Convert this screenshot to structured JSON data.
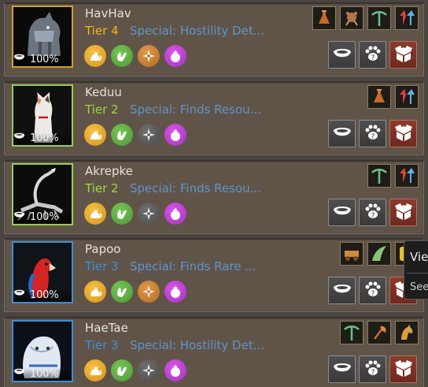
{
  "colors": {
    "tier4": "#f1b51f",
    "tier2": "#9dd83b",
    "tier3": "#3f8fd6",
    "border_gold": "#d4a020",
    "border_green": "#99cc55",
    "border_blue": "#3a8fd5"
  },
  "pets": [
    {
      "name": "HavHav",
      "tier": "Tier 4",
      "tier_color": "#f1b51f",
      "border_color": "#d4a020",
      "special": "Special: Hostility Det...",
      "hunger": "100%",
      "portrait": "armored-dog",
      "skills": [
        "gold-cat",
        "green-paw",
        "orange-compass",
        "purple-bag"
      ],
      "passives": [
        "potion-icon",
        "bear-icon",
        "pickaxe-icon",
        "speed-up-icon"
      ]
    },
    {
      "name": "Keduu",
      "tier": "Tier 2",
      "tier_color": "#9dd83b",
      "border_color": "#99cc55",
      "special": "Special: Finds Resou...",
      "hunger": "100%",
      "portrait": "white-cat",
      "skills": [
        "gold-cat",
        "green-paw",
        "gray-compass",
        "purple-bag"
      ],
      "passives": [
        "potion-icon",
        "speed-up-icon"
      ]
    },
    {
      "name": "Akrepke",
      "tier": "Tier 2",
      "tier_color": "#9dd83b",
      "border_color": "#99cc55",
      "special": "Special: Finds Resou...",
      "hunger": "100%",
      "portrait": "scorpion",
      "skills": [
        "gold-cat",
        "green-paw",
        "gray-compass",
        "purple-bag"
      ],
      "passives": [
        "pickaxe-icon",
        "speed-up-icon"
      ]
    },
    {
      "name": "Papoo",
      "tier": "Tier 3",
      "tier_color": "#3f8fd6",
      "border_color": "#3a8fd5",
      "special": "Special: Finds Rare ...",
      "hunger": "100%",
      "portrait": "red-parrot",
      "skills": [
        "gold-cat",
        "green-paw",
        "orange-compass",
        "purple-bag"
      ],
      "passives": [
        "cart-icon",
        "wing-icon",
        "yellow-icon"
      ]
    },
    {
      "name": "HaeTae",
      "tier": "Tier 3",
      "tier_color": "#3f8fd6",
      "border_color": "#3a8fd5",
      "special": "Special: Hostility Det...",
      "hunger": "100%",
      "portrait": "white-lion",
      "skills": [
        "gold-cat",
        "green-paw",
        "gray-compass",
        "purple-bag"
      ],
      "passives": [
        "pickaxe-icon",
        "axe-icon",
        "horse-icon"
      ]
    }
  ],
  "actions": [
    {
      "name": "feed-button",
      "icon": "bowl-icon"
    },
    {
      "name": "pet-info-button",
      "icon": "paw-question-icon"
    },
    {
      "name": "seal-button",
      "icon": "seal-box-icon"
    }
  ],
  "tooltip": {
    "line1": "Vie",
    "line2": "See"
  }
}
